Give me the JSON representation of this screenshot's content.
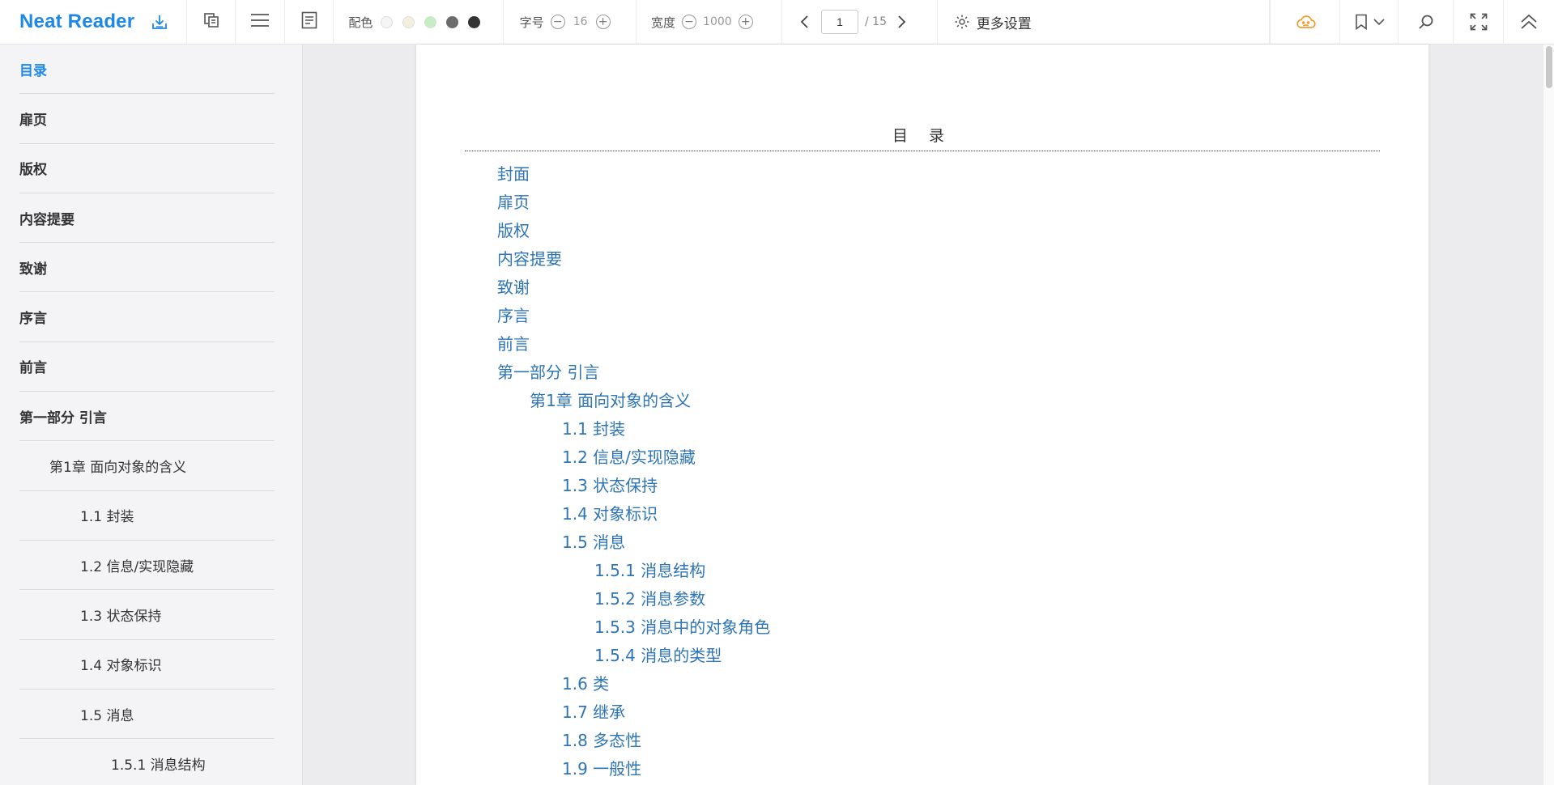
{
  "app": {
    "name": "Neat Reader"
  },
  "toolbar": {
    "color_label": "配色",
    "color_swatches": [
      "#f5f5f5",
      "#f3efdf",
      "#c9ecc6",
      "#6b6b6b",
      "#333333"
    ],
    "font_size_label": "字号",
    "font_size_value": "16",
    "width_label": "宽度",
    "width_value": "1000",
    "page_current": "1",
    "page_total": "/ 15",
    "more_settings_label": "更多设置"
  },
  "sidebar": {
    "items": [
      {
        "label": "目录",
        "active": true
      },
      {
        "label": "扉页"
      },
      {
        "label": "版权"
      },
      {
        "label": "内容提要"
      },
      {
        "label": "致谢"
      },
      {
        "label": "序言"
      },
      {
        "label": "前言"
      },
      {
        "label": "第一部分 引言"
      },
      {
        "label": "第1章 面向对象的含义"
      },
      {
        "label": "1.1 封装"
      },
      {
        "label": "1.2 信息/实现隐藏"
      },
      {
        "label": "1.3 状态保持"
      },
      {
        "label": "1.4 对象标识"
      },
      {
        "label": "1.5 消息"
      },
      {
        "label": "1.5.1 消息结构"
      }
    ]
  },
  "page": {
    "title": "目  录",
    "toc": [
      {
        "label": "封面"
      },
      {
        "label": "扉页"
      },
      {
        "label": "版权"
      },
      {
        "label": "内容提要"
      },
      {
        "label": "致谢"
      },
      {
        "label": "序言"
      },
      {
        "label": "前言"
      },
      {
        "label": "第一部分 引言"
      },
      {
        "label": "第1章 面向对象的含义"
      },
      {
        "label": "1.1 封装"
      },
      {
        "label": "1.2 信息/实现隐藏"
      },
      {
        "label": "1.3 状态保持"
      },
      {
        "label": "1.4 对象标识"
      },
      {
        "label": "1.5 消息"
      },
      {
        "label": "1.5.1 消息结构"
      },
      {
        "label": "1.5.2 消息参数"
      },
      {
        "label": "1.5.3 消息中的对象角色"
      },
      {
        "label": "1.5.4 消息的类型"
      },
      {
        "label": "1.6 类"
      },
      {
        "label": "1.7 继承"
      },
      {
        "label": "1.8 多态性"
      },
      {
        "label": "1.9 一般性"
      }
    ]
  }
}
